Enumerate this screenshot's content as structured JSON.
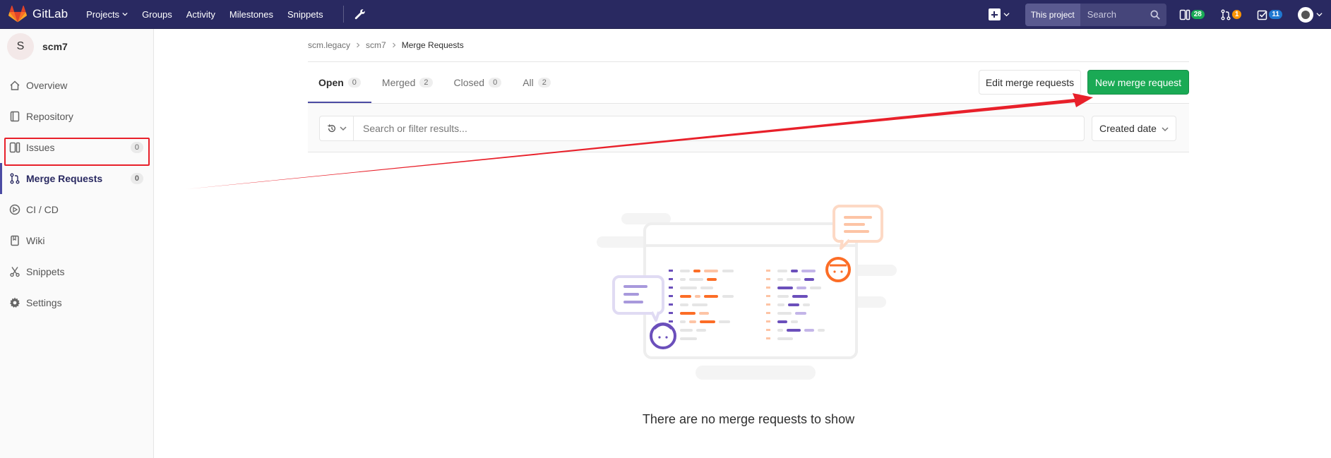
{
  "navbar": {
    "brand": "GitLab",
    "items": [
      {
        "label": "Projects",
        "dropdown": true
      },
      {
        "label": "Groups"
      },
      {
        "label": "Activity"
      },
      {
        "label": "Milestones"
      },
      {
        "label": "Snippets"
      }
    ],
    "search_scope": "This project",
    "search_placeholder": "Search",
    "counters": {
      "todos_pages": {
        "value": "28",
        "color": "#1aaa55"
      },
      "merge_requests": {
        "value": "1",
        "color": "#fc9403"
      },
      "issues": {
        "value": "11",
        "color": "#1f78d1"
      }
    }
  },
  "sidebar": {
    "avatar_letter": "S",
    "project": "scm7",
    "items": [
      {
        "label": "Overview",
        "icon": "home-icon"
      },
      {
        "label": "Repository",
        "icon": "book-icon"
      },
      {
        "label": "Issues",
        "icon": "issues-icon",
        "count": "0"
      },
      {
        "label": "Merge Requests",
        "icon": "merge-request-icon",
        "count": "0",
        "active": true
      },
      {
        "label": "CI / CD",
        "icon": "rocket-icon"
      },
      {
        "label": "Wiki",
        "icon": "wiki-book-icon"
      },
      {
        "label": "Snippets",
        "icon": "scissors-icon"
      },
      {
        "label": "Settings",
        "icon": "gear-icon"
      }
    ]
  },
  "breadcrumb": [
    "scm.legacy",
    "scm7",
    "Merge Requests"
  ],
  "tabs": [
    {
      "label": "Open",
      "count": "0",
      "active": true
    },
    {
      "label": "Merged",
      "count": "2"
    },
    {
      "label": "Closed",
      "count": "0"
    },
    {
      "label": "All",
      "count": "2"
    }
  ],
  "buttons": {
    "edit": "Edit merge requests",
    "new": "New merge request"
  },
  "filter": {
    "placeholder": "Search or filter results...",
    "sort": "Created date"
  },
  "empty_state": "There are no merge requests to show",
  "colors": {
    "navbar": "#292961",
    "primary_green": "#1aaa55",
    "annotation_red": "#e8202a"
  }
}
